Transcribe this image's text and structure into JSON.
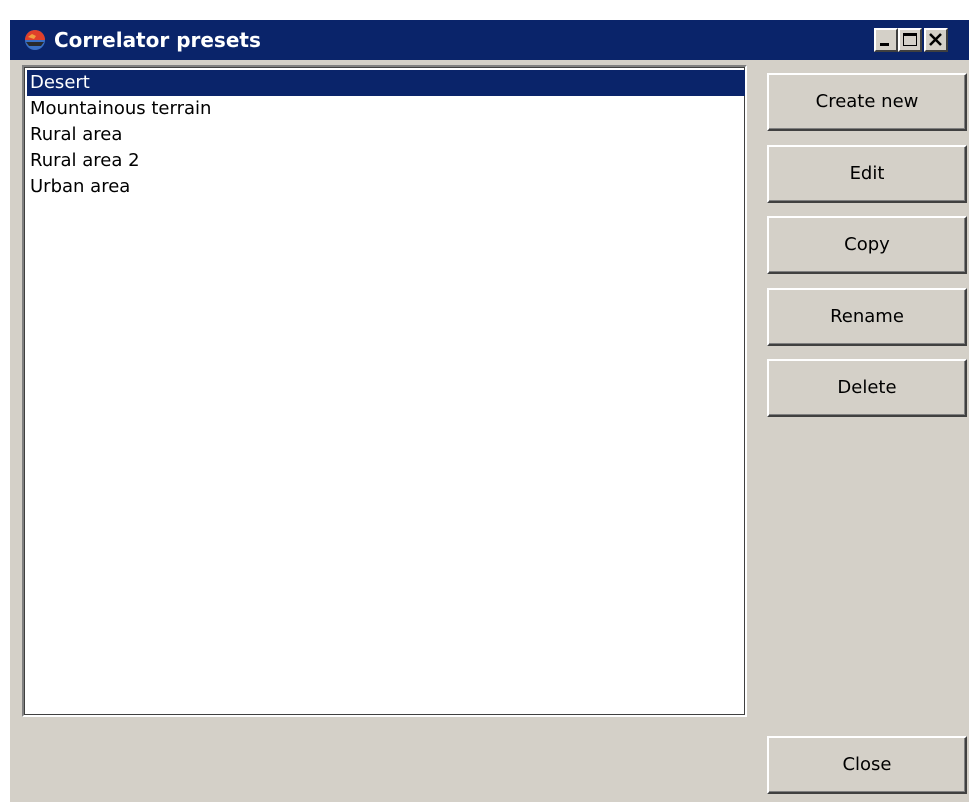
{
  "window": {
    "title": "Correlator presets",
    "icon": "app-globe-icon",
    "controls": {
      "minimize": "minimize-icon",
      "maximize": "maximize-icon",
      "close": "close-icon"
    }
  },
  "presets": {
    "items": [
      {
        "label": "Desert",
        "selected": true
      },
      {
        "label": "Mountainous terrain",
        "selected": false
      },
      {
        "label": "Rural area",
        "selected": false
      },
      {
        "label": "Rural area 2",
        "selected": false
      },
      {
        "label": "Urban area",
        "selected": false
      }
    ]
  },
  "actions": {
    "create_new": "Create new",
    "edit": "Edit",
    "copy": "Copy",
    "rename": "Rename",
    "delete": "Delete",
    "close": "Close"
  },
  "colors": {
    "titlebar": "#0a246a",
    "selection": "#0a246a",
    "face": "#d4d0c8"
  }
}
